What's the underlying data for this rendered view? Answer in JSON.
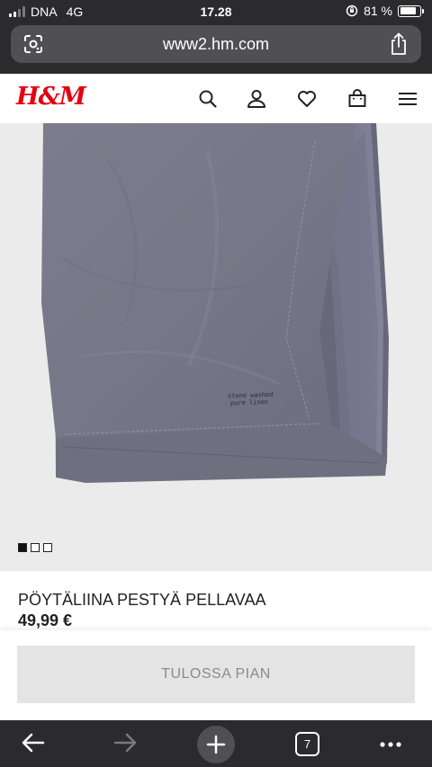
{
  "status_bar": {
    "carrier": "DNA",
    "network": "4G",
    "time": "17.28",
    "battery_text": "81 %",
    "battery_level": 0.81
  },
  "browser": {
    "url": "www2.hm.com",
    "tab_count": "7"
  },
  "site": {
    "logo_text": "H&M",
    "brand_color": "#e50010",
    "header_icons": [
      "search-icon",
      "account-icon",
      "favorites-heart-icon",
      "shopping-bag-icon",
      "menu-hamburger-icon"
    ]
  },
  "product": {
    "image_label": "stone washed pure linen",
    "image_count": 3,
    "active_image": 1,
    "name": "PÖYTÄLIINA PESTYÄ PELLAVAA",
    "price": "49,99 €",
    "cta_label": "TULOSSA PIAN"
  },
  "toolbar": {
    "icons": [
      "back-arrow-icon",
      "forward-arrow-icon",
      "new-tab-plus-icon",
      "tabs-count-icon",
      "more-dots-icon"
    ]
  }
}
